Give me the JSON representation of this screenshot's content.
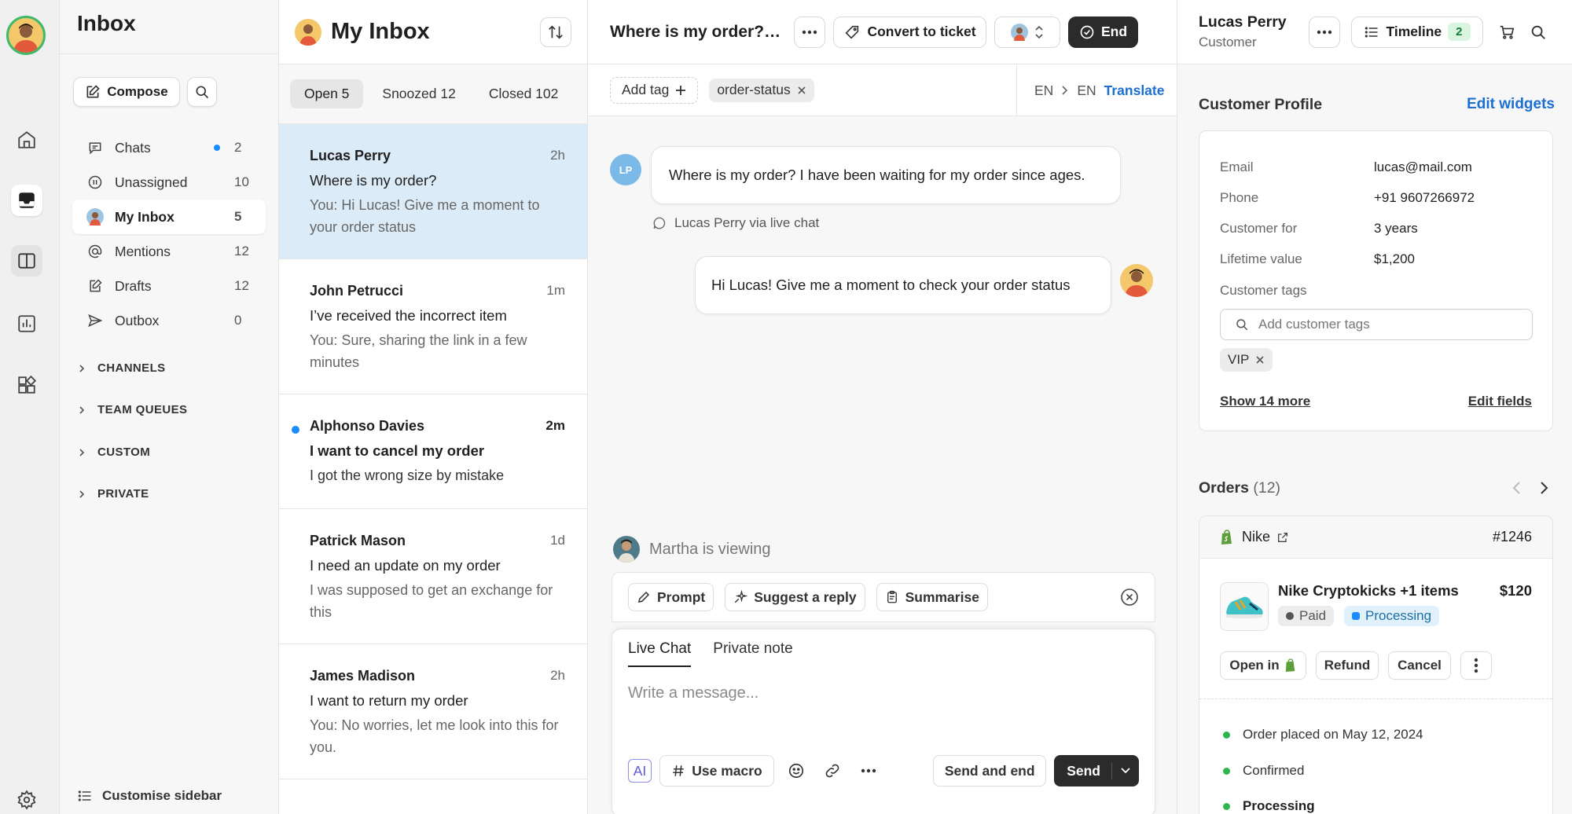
{
  "sidebar": {
    "title": "Inbox",
    "compose_label": "Compose",
    "nav": [
      {
        "label": "Chats",
        "count": "2",
        "unread": true
      },
      {
        "label": "Unassigned",
        "count": "10"
      },
      {
        "label": "My Inbox",
        "count": "5",
        "active": true
      },
      {
        "label": "Mentions",
        "count": "12"
      },
      {
        "label": "Drafts",
        "count": "12"
      },
      {
        "label": "Outbox",
        "count": "0"
      }
    ],
    "groups": [
      "CHANNELS",
      "TEAM QUEUES",
      "CUSTOM",
      "PRIVATE"
    ],
    "customise_label": "Customise sidebar"
  },
  "list": {
    "title": "My Inbox",
    "tabs": [
      {
        "label": "Open 5",
        "active": true
      },
      {
        "label": "Snoozed 12"
      },
      {
        "label": "Closed 102"
      }
    ],
    "conversations": [
      {
        "name": "Lucas Perry",
        "time": "2h",
        "subject": "Where is my order?",
        "preview": "You: Hi Lucas! Give me  a moment to your order status",
        "selected": true
      },
      {
        "name": "John Petrucci",
        "time": "1m",
        "subject": "I’ve received the incorrect item",
        "preview": "You: Sure, sharing the link in a few minutes"
      },
      {
        "name": "Alphonso Davies",
        "time": "2m",
        "subject": "I want to cancel my order",
        "preview": "I got the wrong size by mistake",
        "unread": true
      },
      {
        "name": "Patrick Mason",
        "time": "1d",
        "subject": "I need an update on my order",
        "preview": "I was supposed to get an exchange for this"
      },
      {
        "name": "James Madison",
        "time": "2h",
        "subject": "I want to return my order",
        "preview": "You: No worries, let me look into this for you."
      }
    ]
  },
  "chat": {
    "title": "Where is my order? I have been waiting for my order since ages.",
    "convert_label": "Convert to ticket",
    "end_label": "End",
    "add_tag_label": "Add tag",
    "tag": "order-status",
    "lang_from": "EN",
    "lang_to": "EN",
    "translate_label": "Translate",
    "customer_initials": "LP",
    "customer_message": "Where is my order? I have been waiting for my order since ages.",
    "via_label": "Lucas Perry via live chat",
    "agent_message": "Hi Lucas! Give me  a moment to check your order status",
    "viewing_label": "Martha is viewing",
    "ai_actions": [
      "Prompt",
      "Suggest a reply",
      "Summarise"
    ],
    "composer_tabs": [
      "Live Chat",
      "Private note"
    ],
    "composer_placeholder": "Write a message...",
    "ai_label": "AI",
    "macro_label": "Use macro",
    "send_and_end_label": "Send and end",
    "send_label": "Send"
  },
  "customer": {
    "name": "Lucas Perry",
    "role": "Customer",
    "timeline_label": "Timeline",
    "timeline_count": "2",
    "profile_title": "Customer Profile",
    "edit_widgets_label": "Edit widgets",
    "fields": [
      {
        "key": "Email",
        "value": "lucas@mail.com"
      },
      {
        "key": "Phone",
        "value": "+91 9607266972"
      },
      {
        "key": "Customer for",
        "value": "3 years"
      },
      {
        "key": "Lifetime value",
        "value": "$1,200"
      }
    ],
    "tags_label": "Customer tags",
    "tags_placeholder": "Add customer tags",
    "tags": [
      "VIP"
    ],
    "show_more_label": "Show 14 more",
    "edit_fields_label": "Edit fields"
  },
  "orders": {
    "title": "Orders",
    "count": "(12)",
    "store": "Nike",
    "order_id": "#1246",
    "product": "Nike Cryptokicks +1 items",
    "price": "$120",
    "paid_label": "Paid",
    "status_label": "Processing",
    "open_in_label": "Open in",
    "refund_label": "Refund",
    "cancel_label": "Cancel",
    "timeline": [
      "Order placed on May 12, 2024",
      "Confirmed",
      "Processing"
    ]
  },
  "colors": {
    "accent": "#1a8cff",
    "selected_row": "#dcebf8",
    "link": "#1a6fd1",
    "success": "#2db54e"
  },
  "icons": [
    "home-icon",
    "inbox-icon",
    "panels-icon",
    "chart-icon",
    "apps-icon",
    "settings-icon",
    "chat-bubble-icon",
    "unassigned-icon",
    "at-icon",
    "drafts-icon",
    "outbox-icon",
    "sort-icon",
    "ticket-icon",
    "check-circle-icon",
    "cart-icon",
    "search-icon",
    "list-icon",
    "shopify-icon",
    "external-link-icon"
  ]
}
